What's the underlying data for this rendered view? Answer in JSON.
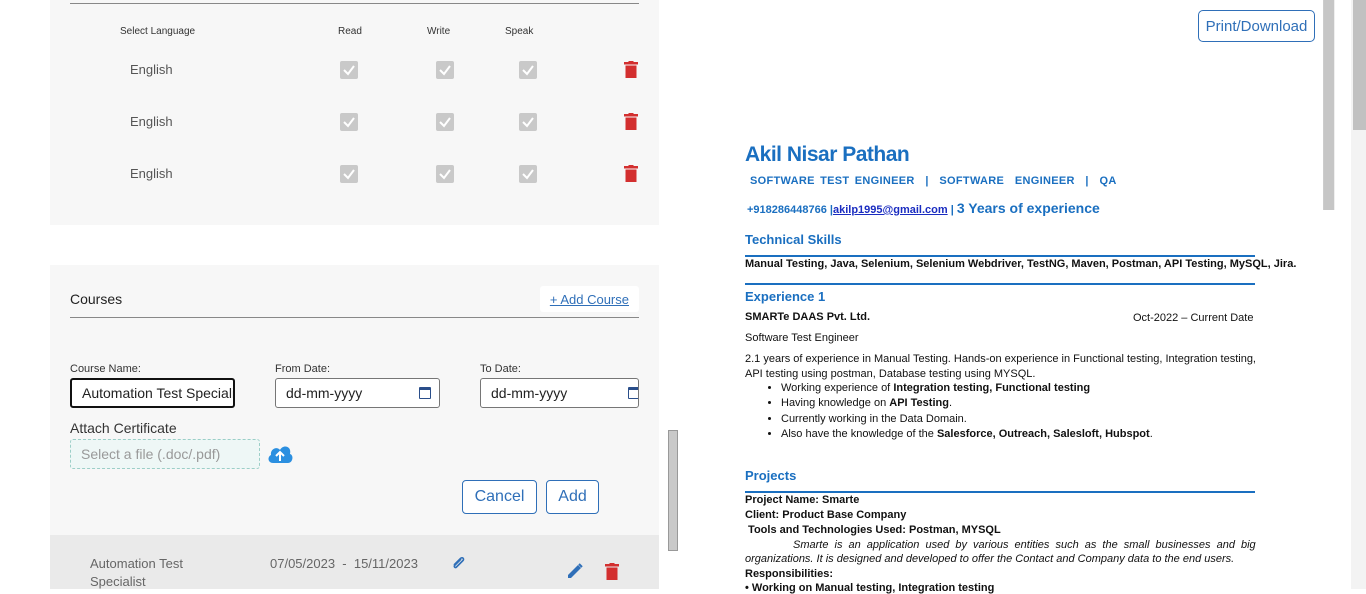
{
  "languages": {
    "headers": {
      "select": "Select Language",
      "read": "Read",
      "write": "Write",
      "speak": "Speak"
    },
    "rows": [
      {
        "name": "English"
      },
      {
        "name": "English"
      },
      {
        "name": "English"
      }
    ]
  },
  "courses": {
    "title": "Courses",
    "add_label": "+ Add Course",
    "course_name_label": "Course Name:",
    "course_name_value": "Automation Test Speciali",
    "from_label": "From Date:",
    "from_value": "dd-mm-yyyy",
    "to_label": "To Date:",
    "to_value": "dd-mm-yyyy",
    "attach_label": "Attach Certificate",
    "file_placeholder": "Select a file (.doc/.pdf)",
    "cancel_label": "Cancel",
    "add_btn_label": "Add",
    "entry": {
      "name_line1": "Automation Test",
      "name_line2": "Specialist",
      "dates": "07/05/2023  -  15/11/2023"
    }
  },
  "resume": {
    "print_label": "Print/Download",
    "name": "Akil Nisar Pathan",
    "role": "SOFTWARE TEST ENGINEER  |  SOFTWARE  ENGINEER  |  QA",
    "phone": "+918286448766 |",
    "email": "akilp1995@gmail.com",
    "sep": " | ",
    "experience": "3 Years of experience",
    "skills_heading": "Technical Skills",
    "skills": "Manual Testing, Java, Selenium, Selenium Webdriver, TestNG, Maven, Postman, API Testing, MySQL, Jira.",
    "exp_heading": "Experience 1",
    "company": "SMARTe DAAS Pvt. Ltd.",
    "period": "Oct-2022 – Current Date",
    "job_title": "Software Test Engineer",
    "summary1": "2.1 years of experience in Manual Testing. Hands-on experience in Functional testing, Integration testing,",
    "summary2": "API testing using postman, Database testing using MYSQL.",
    "bullets": [
      {
        "pre": "Working experience of ",
        "bold": "Integration testing, Functional testing",
        "post": ""
      },
      {
        "pre": "Having knowledge on ",
        "bold": "API Testing",
        "post": "."
      },
      {
        "pre": "Currently working in the Data Domain.",
        "bold": "",
        "post": ""
      },
      {
        "pre": "Also have the knowledge of the ",
        "bold": "Salesforce, Outreach, Salesloft, Hubspot",
        "post": "."
      }
    ],
    "projects_heading": "Projects",
    "project_name": "Project Name: Smarte",
    "client": "Client: Product Base Company",
    "tools": " Tools and Technologies Used: Postman, MYSQL",
    "desc1": "Smarte is an application used by various entities such as the small businesses and big",
    "desc2": "organizations. It is designed and developed to offer the Contact and Company data to the end users.",
    "resp_heading": "Responsibilities:",
    "resp_partial": "• Working on Manual testing, Integration testing"
  }
}
